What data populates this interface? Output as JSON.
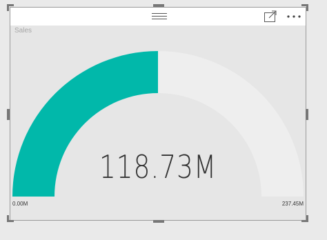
{
  "visual": {
    "title": "Sales",
    "menu": {
      "drag_icon": "drag-handle-icon",
      "focus_icon": "focus-mode-icon",
      "more_icon": "more-options-icon"
    }
  },
  "chart_data": {
    "type": "gauge",
    "title": "Sales",
    "value": 118.73,
    "value_label": "118.73M",
    "min": 0,
    "max": 237.45,
    "min_label": "0.00M",
    "max_label": "237.45M",
    "unit": "M",
    "fill_color": "#01b8aa",
    "track_color": "#eeeeee"
  }
}
